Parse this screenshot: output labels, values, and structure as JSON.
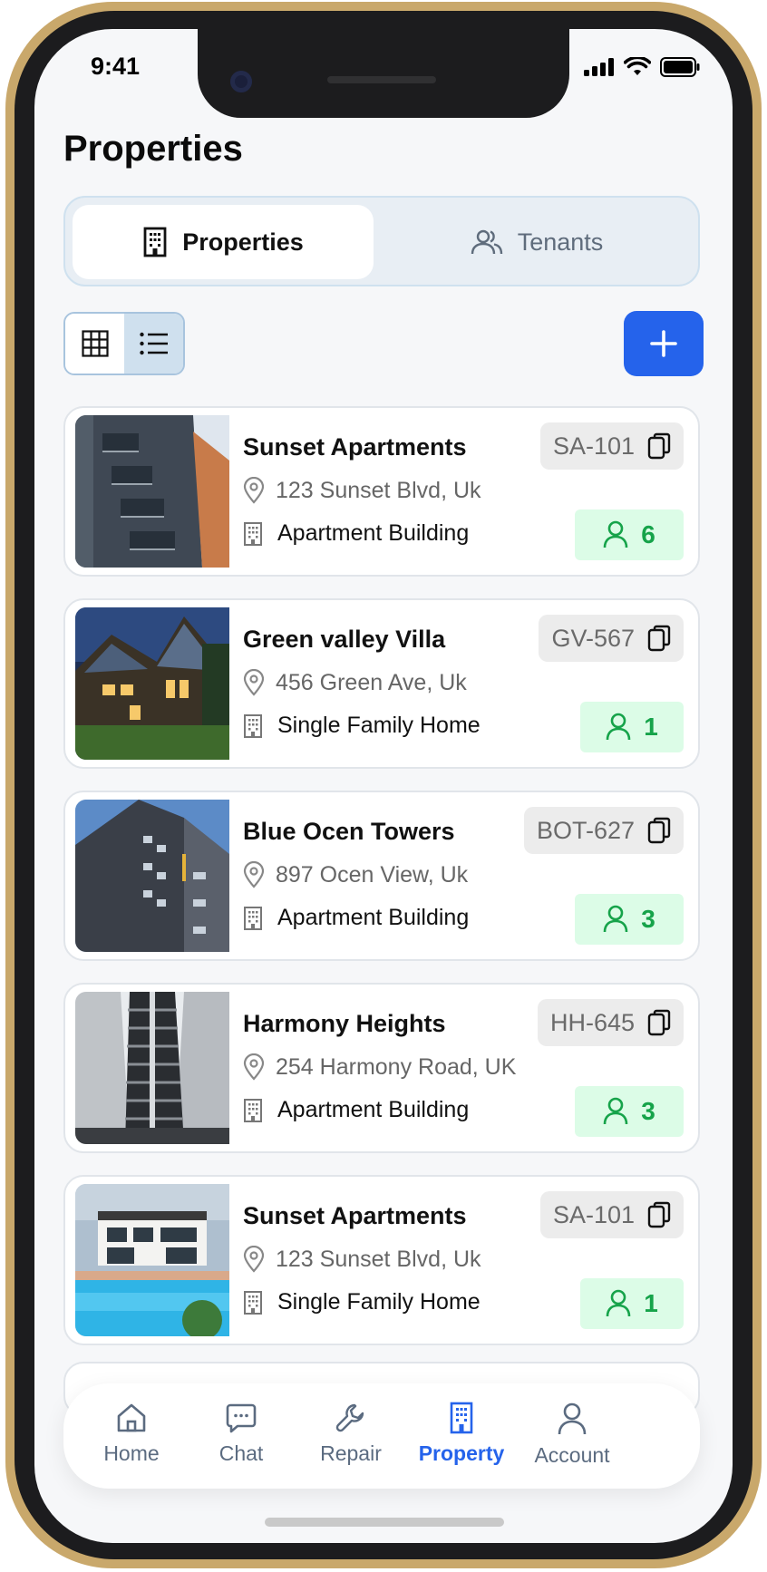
{
  "status": {
    "time": "9:41"
  },
  "page": {
    "title": "Properties"
  },
  "segments": [
    {
      "label": "Properties",
      "icon": "building-icon",
      "active": true
    },
    {
      "label": "Tenants",
      "icon": "users-icon",
      "active": false
    }
  ],
  "view_toggle": {
    "options": [
      "grid-view-icon",
      "list-view-icon"
    ],
    "selected": "list"
  },
  "properties": [
    {
      "name": "Sunset Apartments",
      "code": "SA-101",
      "address": "123 Sunset Blvd, Uk",
      "type": "Apartment Building",
      "tenants": "6"
    },
    {
      "name": "Green valley Villa",
      "code": "GV-567",
      "address": "456 Green Ave, Uk",
      "type": "Single Family Home",
      "tenants": "1"
    },
    {
      "name": "Blue Ocen Towers",
      "code": "BOT-627",
      "address": "897 Ocen View, Uk",
      "type": "Apartment Building",
      "tenants": "3"
    },
    {
      "name": "Harmony Heights",
      "code": "HH-645",
      "address": "254 Harmony Road, UK",
      "type": "Apartment Building",
      "tenants": "3"
    },
    {
      "name": "Sunset Apartments",
      "code": "SA-101",
      "address": "123 Sunset Blvd, Uk",
      "type": "Single Family Home",
      "tenants": "1"
    }
  ],
  "nav": [
    {
      "label": "Home",
      "icon": "home-icon",
      "active": false
    },
    {
      "label": "Chat",
      "icon": "chat-icon",
      "active": false
    },
    {
      "label": "Repair",
      "icon": "wrench-icon",
      "active": false
    },
    {
      "label": "Property",
      "icon": "building-icon",
      "active": true
    },
    {
      "label": "Account",
      "icon": "user-icon",
      "active": false
    }
  ],
  "colors": {
    "accent": "#2563eb",
    "tenant_badge_bg": "#dcfce7",
    "tenant_badge_text": "#16a34a",
    "frame": "#c9a86b"
  }
}
